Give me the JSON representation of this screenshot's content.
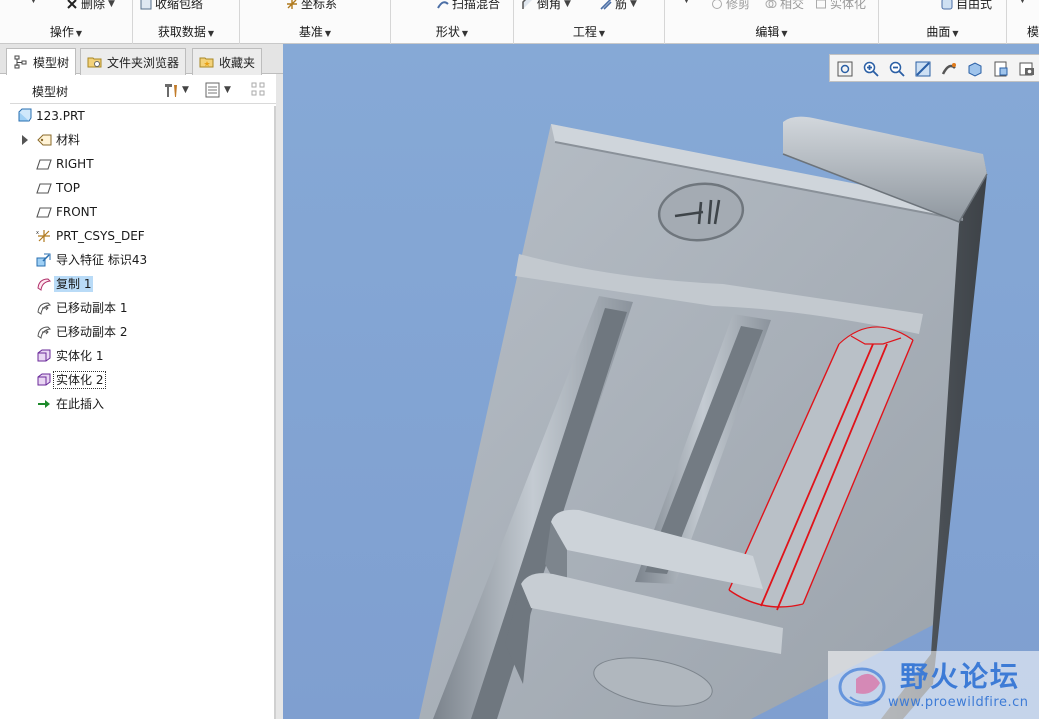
{
  "ribbon": {
    "groups": [
      {
        "label": "操作",
        "commands": [
          {
            "label": "删除",
            "icon": "delete-x-icon",
            "dropdown": true
          }
        ]
      },
      {
        "label": "获取数据",
        "commands": [
          {
            "label": "收缩包络",
            "icon": "shrinkwrap-icon"
          }
        ]
      },
      {
        "label": "基准",
        "commands": [
          {
            "label": "坐标系",
            "icon": "coordinate-system-icon"
          }
        ]
      },
      {
        "label": "形状",
        "commands": [
          {
            "label": "扫描混合",
            "icon": "swept-blend-icon"
          }
        ]
      },
      {
        "label": "工程",
        "commands": [
          {
            "label": "倒角",
            "icon": "chamfer-icon",
            "dropdown": true
          },
          {
            "label": "筋",
            "icon": "rib-icon",
            "dropdown": true
          }
        ]
      },
      {
        "label": "编辑",
        "commands": [
          {
            "label": "修剪",
            "icon": "trim-icon",
            "disabled": true
          },
          {
            "label": "相交",
            "icon": "intersect-icon",
            "disabled": true
          },
          {
            "label": "实体化",
            "icon": "solidify-icon",
            "disabled": true
          }
        ]
      },
      {
        "label": "曲面",
        "commands": [
          {
            "label": "自由式",
            "icon": "freestyle-icon"
          }
        ]
      },
      {
        "label": "模",
        "commands": []
      }
    ]
  },
  "panel": {
    "tabs": [
      {
        "label": "模型树",
        "icon": "model-tree-icon",
        "active": true
      },
      {
        "label": "文件夹浏览器",
        "icon": "folder-browser-icon",
        "active": false
      },
      {
        "label": "收藏夹",
        "icon": "favorites-icon",
        "active": false
      }
    ],
    "tree_title": "模型树",
    "tree_items": [
      {
        "label": "123.PRT",
        "icon": "part-icon",
        "indent": 0
      },
      {
        "label": "材料",
        "icon": "material-tag-icon",
        "indent": 1,
        "expandable": true
      },
      {
        "label": "RIGHT",
        "icon": "datum-plane-icon",
        "indent": 1
      },
      {
        "label": "TOP",
        "icon": "datum-plane-icon",
        "indent": 1
      },
      {
        "label": "FRONT",
        "icon": "datum-plane-icon",
        "indent": 1
      },
      {
        "label": "PRT_CSYS_DEF",
        "icon": "csys-icon",
        "indent": 1
      },
      {
        "label": "导入特征 标识43",
        "icon": "import-feature-icon",
        "indent": 1
      },
      {
        "label": "复制 1",
        "icon": "copy-surface-icon",
        "indent": 1,
        "selected": true
      },
      {
        "label": "已移动副本 1",
        "icon": "moved-copy-icon",
        "indent": 1
      },
      {
        "label": "已移动副本 2",
        "icon": "moved-copy-icon",
        "indent": 1
      },
      {
        "label": "实体化 1",
        "icon": "solidify-feature-icon",
        "indent": 1
      },
      {
        "label": "实体化 2",
        "icon": "solidify-feature-icon",
        "indent": 1,
        "focused": true
      },
      {
        "label": "在此插入",
        "icon": "insert-here-arrow-icon",
        "indent": 1
      }
    ]
  },
  "viewport": {
    "toolbar_icons": [
      "refit-icon",
      "zoom-in-icon",
      "zoom-out-icon",
      "repaint-icon",
      "spin-center-icon",
      "display-style-icon",
      "saved-views-icon",
      "view-manager-icon"
    ]
  },
  "watermark": {
    "title": "野火论坛",
    "url": "www.proewildfire.cn"
  },
  "colors": {
    "viewport_bg": "#86a9d6",
    "model_gray": "#a9b0b8",
    "highlight_red": "#e0131a",
    "selection_bg": "#b9dbf7",
    "watermark_blue": "#3d7bd6"
  }
}
